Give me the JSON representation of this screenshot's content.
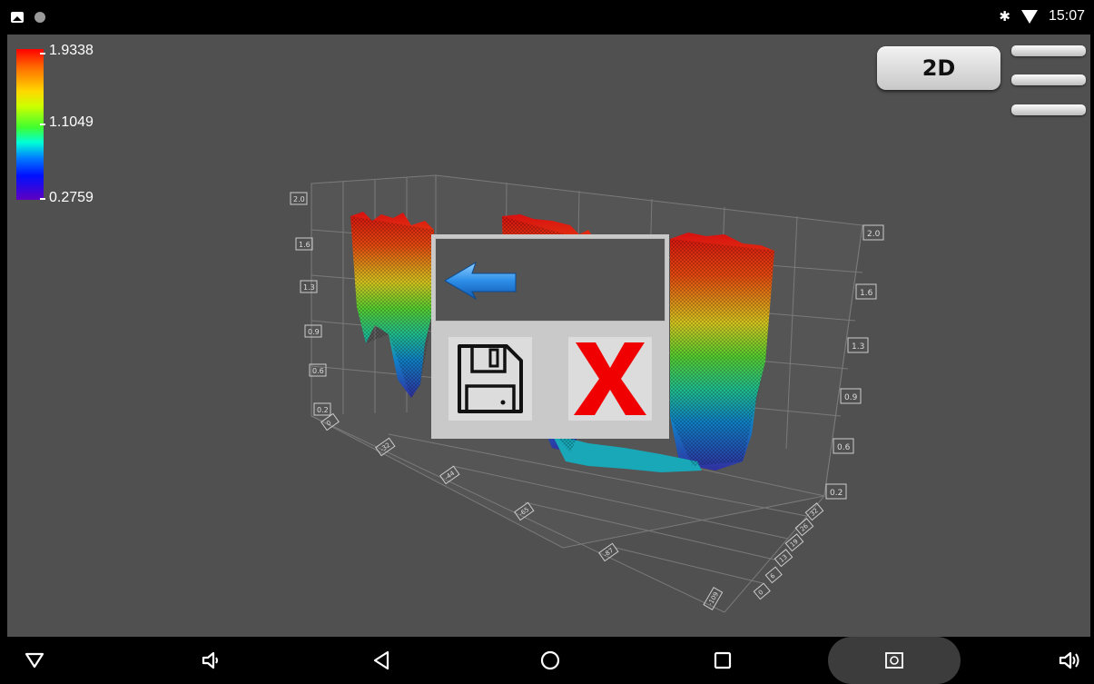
{
  "status_bar": {
    "time": "15:07",
    "left_icons": [
      "image-icon",
      "circle-icon"
    ],
    "right_icons": [
      "bluetooth-icon",
      "wifi-icon"
    ]
  },
  "legend": {
    "max": "1.9338",
    "mid": "1.1049",
    "min": "0.2759"
  },
  "buttons": {
    "view_toggle": "2D"
  },
  "chart_data": {
    "type": "surface",
    "title": "",
    "z_ticks_left": [
      "2.0",
      "1.6",
      "1.3",
      "0.9",
      "0.6",
      "0.2"
    ],
    "z_ticks_right": [
      "2.0",
      "1.6",
      "1.3",
      "0.9",
      "0.6",
      "0.2"
    ],
    "x_ticks": [
      "0",
      "-32",
      "-44",
      "-65",
      "-87",
      "-109"
    ],
    "y_ticks": [
      "0",
      "6",
      "13",
      "19",
      "26",
      "32"
    ],
    "z_range": [
      0.2759,
      1.9338
    ],
    "colormap": "rainbow",
    "grid": true
  },
  "dialog": {
    "icons": [
      "back-arrow-icon",
      "save-icon",
      "close-icon"
    ]
  },
  "nav_bar": {
    "icons": [
      "collapse-icon",
      "volume-down-icon",
      "back-icon",
      "home-icon",
      "recents-icon",
      "screenshot-icon",
      "volume-up-icon"
    ]
  }
}
